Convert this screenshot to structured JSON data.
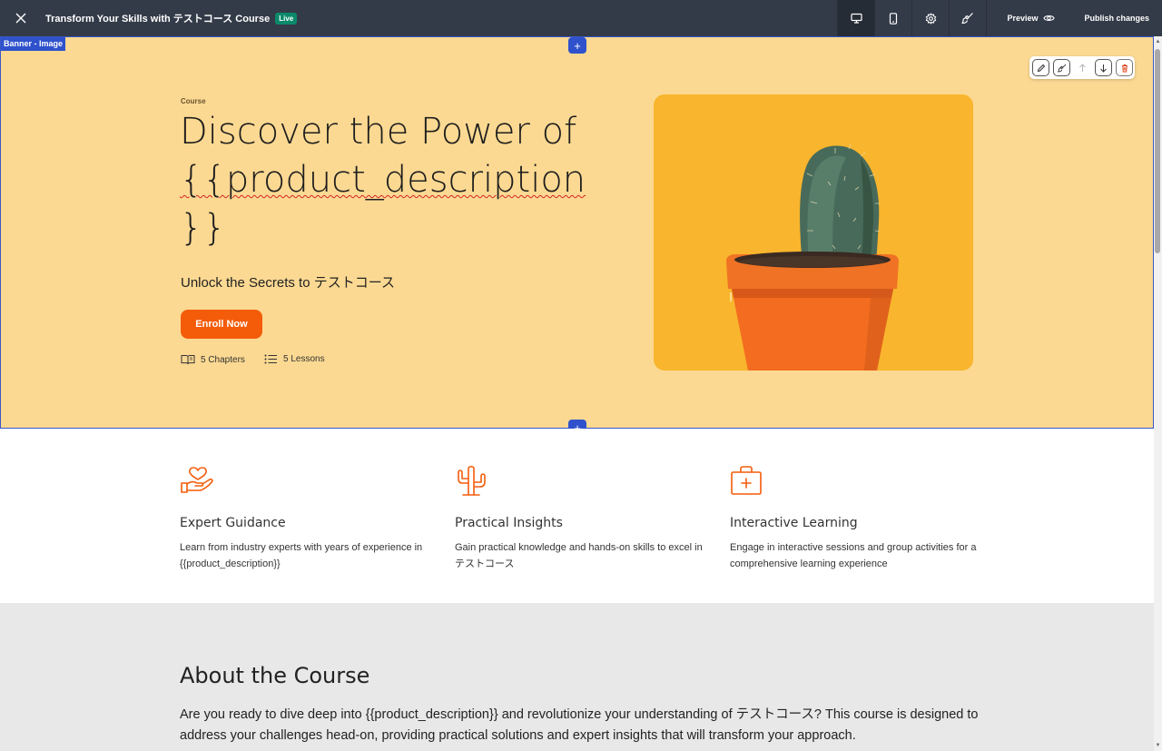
{
  "topbar": {
    "title": "Transform Your Skills with テストコース Course",
    "live_badge": "Live",
    "preview_label": "Preview",
    "publish_label": "Publish changes",
    "icons": [
      "close-icon",
      "desktop-icon",
      "mobile-icon",
      "settings-icon",
      "brush-icon",
      "eye-icon"
    ]
  },
  "banner": {
    "block_label": "Banner - Image",
    "add_symbol": "+",
    "course_label": "Course",
    "title_line1": "Discover the Power of",
    "title_line2": "{{product_description",
    "title_line3": "}}",
    "subtitle": "Unlock the Secrets to テストコース",
    "enroll_label": "Enroll Now",
    "chapters": "5 Chapters",
    "lessons": "5 Lessons",
    "colors": {
      "background": "#fcd992",
      "accent": "#f45c0a",
      "image_bg": "#f8b52d"
    }
  },
  "features": [
    {
      "title": "Expert Guidance",
      "text": "Learn from industry experts with years of experience in {{product_description}}",
      "icon": "hand-heart-icon"
    },
    {
      "title": "Practical Insights",
      "text": "Gain practical knowledge and hands-on skills to excel in テストコース",
      "icon": "cactus-icon"
    },
    {
      "title": "Interactive Learning",
      "text": "Engage in interactive sessions and group activities for a comprehensive learning experience",
      "icon": "first-aid-kit-icon"
    }
  ],
  "about": {
    "heading": "About the Course",
    "text": "Are you ready to dive deep into {{product_description}} and revolutionize your understanding of テストコース? This course is designed to address your challenges head-on, providing practical solutions and expert insights that will transform your approach."
  }
}
